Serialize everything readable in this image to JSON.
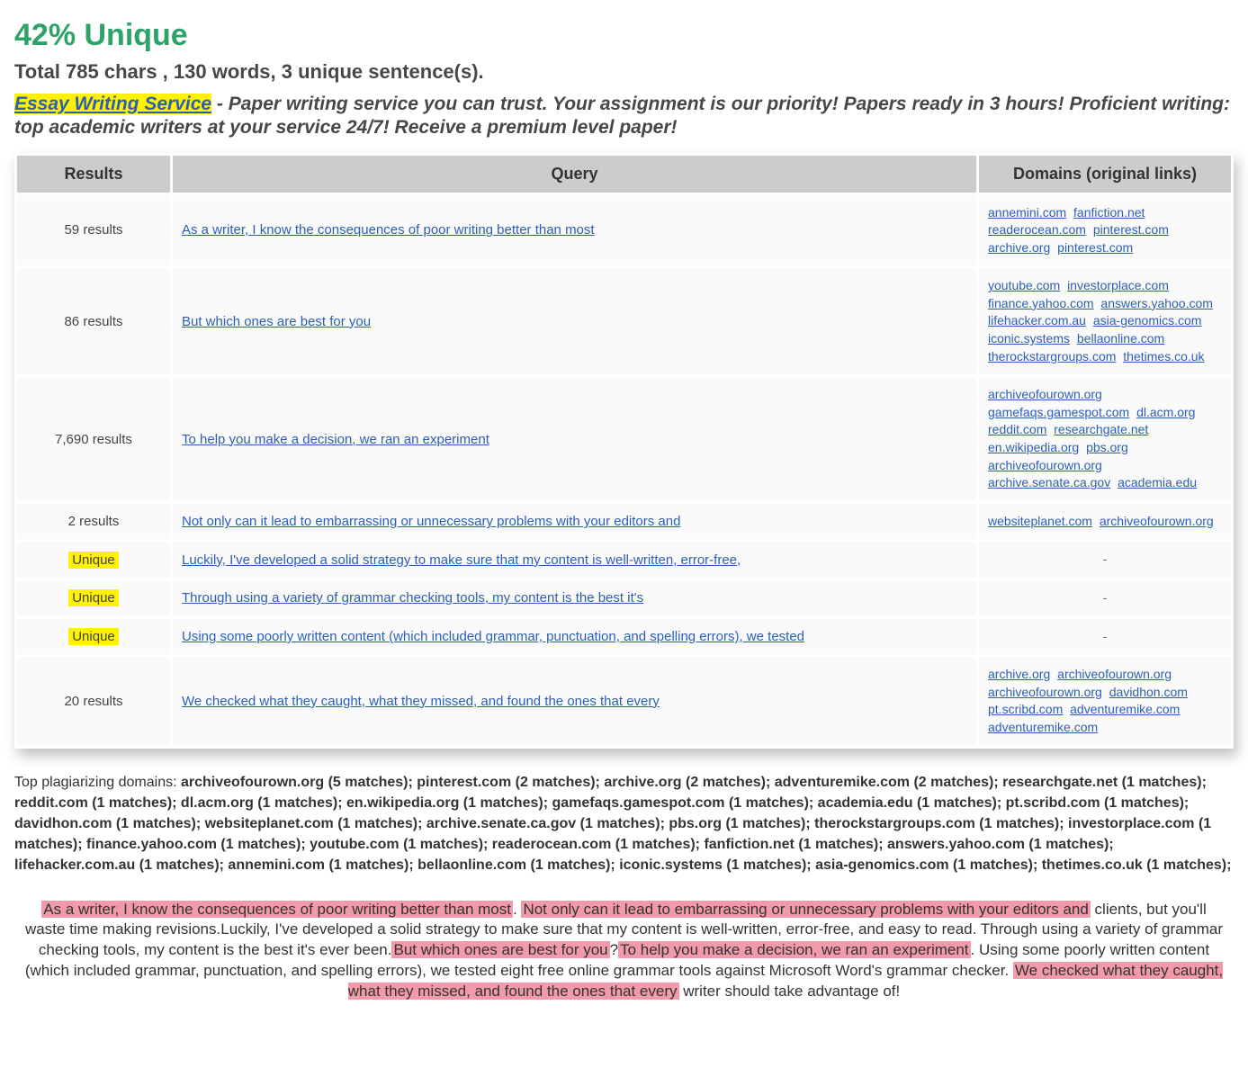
{
  "title": "42% Unique",
  "stats": "Total 785 chars , 130 words, 3 unique sentence(s).",
  "promo": {
    "link_text": "Essay Writing Service",
    "desc": " - Paper writing service you can trust. Your assignment is our priority! Papers ready in 3 hours! Proficient writing: top academic writers at your service 24/7! Receive a premium level paper!"
  },
  "headers": {
    "results": "Results",
    "query": "Query",
    "domains": "Domains (original links)"
  },
  "rows": [
    {
      "results": "59 results",
      "unique": false,
      "query": "As a writer, I know the consequences of poor writing better than most",
      "domains": [
        "annemini.com",
        "fanfiction.net",
        "readerocean.com",
        "pinterest.com",
        "archive.org",
        "pinterest.com"
      ]
    },
    {
      "results": "86 results",
      "unique": false,
      "query": "But which ones are best for you",
      "domains": [
        "youtube.com",
        "investorplace.com",
        "finance.yahoo.com",
        "answers.yahoo.com",
        "lifehacker.com.au",
        "asia-genomics.com",
        "iconic.systems",
        "bellaonline.com",
        "therockstargroups.com",
        "thetimes.co.uk"
      ]
    },
    {
      "results": "7,690 results",
      "unique": false,
      "query": "To help you make a decision, we ran an experiment",
      "domains": [
        "archiveofourown.org",
        "gamefaqs.gamespot.com",
        "dl.acm.org",
        "reddit.com",
        "researchgate.net",
        "en.wikipedia.org",
        "pbs.org",
        "archiveofourown.org",
        "archive.senate.ca.gov",
        "academia.edu"
      ]
    },
    {
      "results": "2 results",
      "unique": false,
      "query": "Not only can it lead to embarrassing or unnecessary problems with your editors and",
      "domains": [
        "websiteplanet.com",
        "archiveofourown.org"
      ]
    },
    {
      "results": "Unique",
      "unique": true,
      "query": "Luckily, I've developed a solid strategy to make sure that my content is well-written, error-free,",
      "domains": []
    },
    {
      "results": "Unique",
      "unique": true,
      "query": "Through using a variety of grammar checking tools, my content is the best it's",
      "domains": []
    },
    {
      "results": "Unique",
      "unique": true,
      "query": "Using some poorly written content (which included grammar, punctuation, and spelling errors), we tested",
      "domains": []
    },
    {
      "results": "20 results",
      "unique": false,
      "query": "We checked what they caught, what they missed, and found the ones that every",
      "domains": [
        "archive.org",
        "archiveofourown.org",
        "archiveofourown.org",
        "davidhon.com",
        "pt.scribd.com",
        "adventuremike.com",
        "adventuremike.com"
      ]
    }
  ],
  "top_domains": {
    "label": "Top plagiarizing domains: ",
    "list": "archiveofourown.org (5 matches); pinterest.com (2 matches); archive.org (2 matches); adventuremike.com (2 matches); researchgate.net (1 matches); reddit.com (1 matches); dl.acm.org (1 matches); en.wikipedia.org (1 matches); gamefaqs.gamespot.com (1 matches); academia.edu (1 matches); pt.scribd.com (1 matches); davidhon.com (1 matches); websiteplanet.com (1 matches); archive.senate.ca.gov (1 matches); pbs.org (1 matches); therockstargroups.com (1 matches); investorplace.com (1 matches); finance.yahoo.com (1 matches); youtube.com (1 matches); readerocean.com (1 matches); fanfiction.net (1 matches); answers.yahoo.com (1 matches); lifehacker.com.au (1 matches); annemini.com (1 matches); bellaonline.com (1 matches); iconic.systems (1 matches); asia-genomics.com (1 matches); thetimes.co.uk (1 matches);"
  },
  "essay": [
    {
      "t": "As a writer, I know the consequences of poor writing better than most",
      "hl": true
    },
    {
      "t": ". ",
      "hl": false
    },
    {
      "t": "Not only can it lead to embarrassing or unnecessary problems with your editors and",
      "hl": true
    },
    {
      "t": " clients, but you'll waste time making revisions.Luckily, I've developed a solid strategy to make sure that my content is well-written, error-free, and easy to read. Through using a variety of grammar checking tools, my content is the best it's ever been.",
      "hl": false
    },
    {
      "t": "But which ones are best for you",
      "hl": true
    },
    {
      "t": "?",
      "hl": false
    },
    {
      "t": "To help you make a decision, we ran an experiment",
      "hl": true
    },
    {
      "t": ". Using some poorly written content (which included grammar, punctuation, and spelling errors), we tested eight free online grammar tools against Microsoft Word's grammar checker. ",
      "hl": false
    },
    {
      "t": "We checked what they caught, what they missed, and found the ones that every",
      "hl": true
    },
    {
      "t": " writer should take advantage of!",
      "hl": false
    }
  ]
}
